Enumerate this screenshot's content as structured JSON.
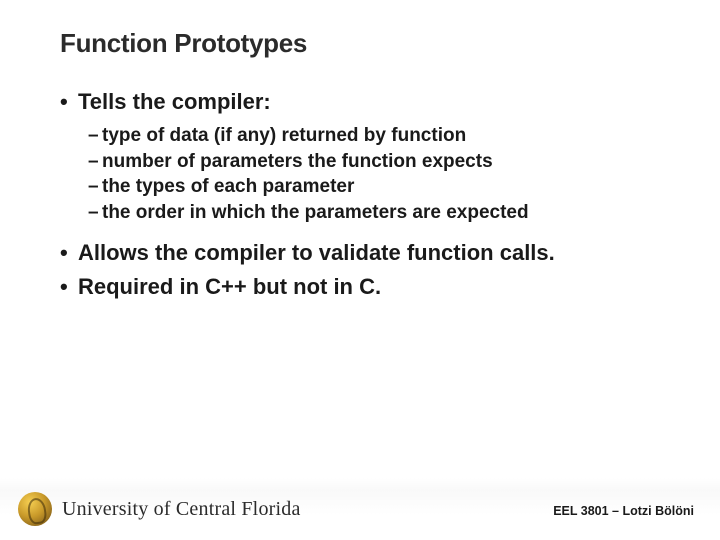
{
  "title": "Function Prototypes",
  "bullets": [
    {
      "text": "Tells the compiler:",
      "sub": [
        "type of data (if any) returned by function",
        "number of parameters the function expects",
        "the types of each parameter",
        "the order in which the parameters are expected"
      ]
    },
    {
      "text": "Allows the compiler to validate function calls.",
      "sub": []
    },
    {
      "text": "Required in C++ but not in C.",
      "sub": []
    }
  ],
  "footer": {
    "university": "University of Central Florida",
    "course": "EEL 3801 – Lotzi Bölöni"
  }
}
